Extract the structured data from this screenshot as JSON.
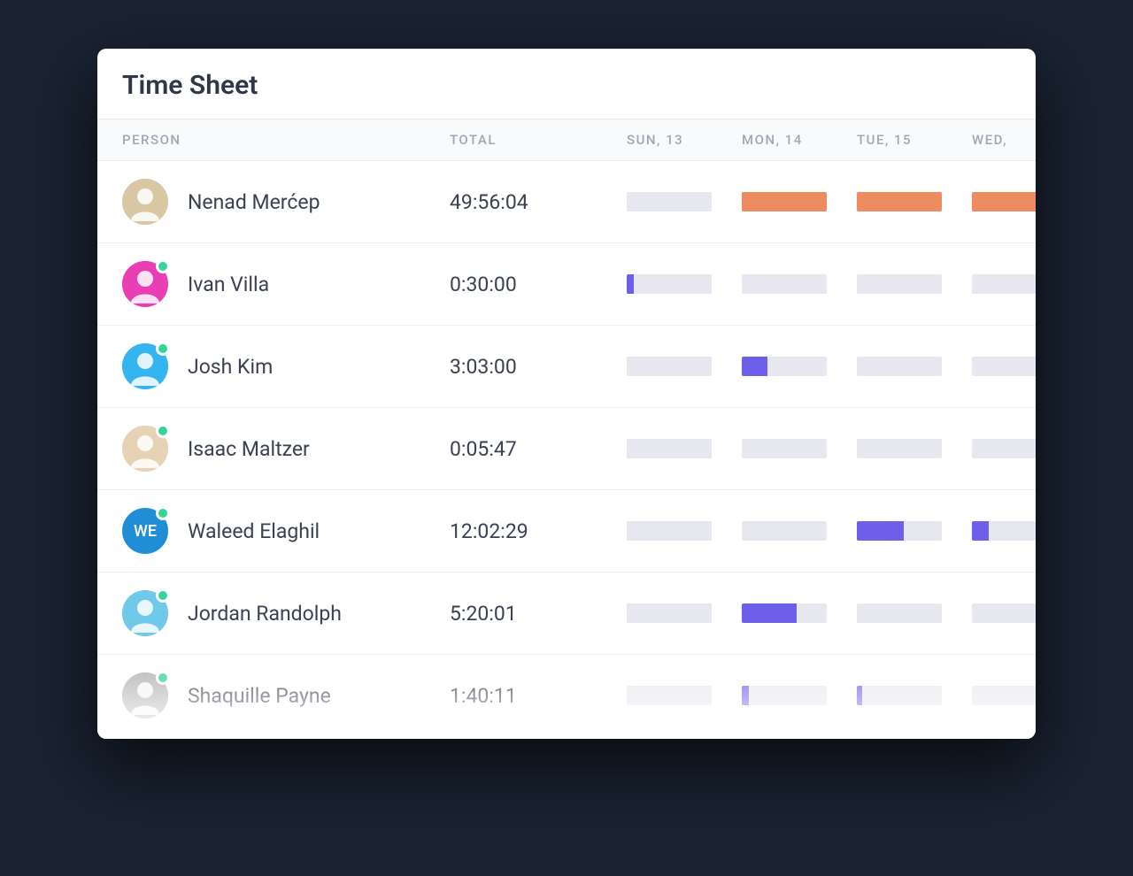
{
  "title": "Time Sheet",
  "columns": {
    "person": "PERSON",
    "total": "TOTAL",
    "days": [
      "SUN, 13",
      "MON, 14",
      "TUE, 15",
      "WED,"
    ]
  },
  "colors": {
    "orange": "#ee8b61",
    "purple": "#6e5fea",
    "track": "#e7e8ef"
  },
  "rows": [
    {
      "name": "Nenad Merćep",
      "total": "49:56:04",
      "presence": false,
      "avatar": {
        "type": "photo",
        "bg": "#d9c7a3"
      },
      "bars": [
        {
          "pct": 0,
          "color": "orange"
        },
        {
          "pct": 100,
          "color": "orange"
        },
        {
          "pct": 100,
          "color": "orange"
        },
        {
          "pct": 100,
          "color": "orange"
        }
      ]
    },
    {
      "name": "Ivan Villa",
      "total": "0:30:00",
      "presence": true,
      "avatar": {
        "type": "photo",
        "bg": "#e83fb5"
      },
      "bars": [
        {
          "pct": 8,
          "color": "purple"
        },
        {
          "pct": 0,
          "color": "purple"
        },
        {
          "pct": 0,
          "color": "purple"
        },
        {
          "pct": 0,
          "color": "purple"
        }
      ]
    },
    {
      "name": "Josh Kim",
      "total": "3:03:00",
      "presence": true,
      "avatar": {
        "type": "photo",
        "bg": "#35b5ef"
      },
      "bars": [
        {
          "pct": 0,
          "color": "purple"
        },
        {
          "pct": 30,
          "color": "purple"
        },
        {
          "pct": 0,
          "color": "purple"
        },
        {
          "pct": 0,
          "color": "purple"
        }
      ]
    },
    {
      "name": "Isaac Maltzer",
      "total": "0:05:47",
      "presence": true,
      "avatar": {
        "type": "photo",
        "bg": "#e6d2b5"
      },
      "bars": [
        {
          "pct": 0,
          "color": "purple"
        },
        {
          "pct": 0,
          "color": "purple"
        },
        {
          "pct": 0,
          "color": "purple"
        },
        {
          "pct": 0,
          "color": "purple"
        }
      ]
    },
    {
      "name": "Waleed Elaghil",
      "total": "12:02:29",
      "presence": true,
      "avatar": {
        "type": "initials",
        "text": "WE",
        "bg": "#1f8ed6"
      },
      "bars": [
        {
          "pct": 0,
          "color": "purple"
        },
        {
          "pct": 0,
          "color": "purple"
        },
        {
          "pct": 55,
          "color": "purple"
        },
        {
          "pct": 20,
          "color": "purple"
        }
      ]
    },
    {
      "name": "Jordan Randolph",
      "total": "5:20:01",
      "presence": true,
      "avatar": {
        "type": "photo",
        "bg": "#6fc9e8"
      },
      "bars": [
        {
          "pct": 0,
          "color": "purple"
        },
        {
          "pct": 65,
          "color": "purple"
        },
        {
          "pct": 0,
          "color": "purple"
        },
        {
          "pct": 0,
          "color": "purple"
        }
      ]
    },
    {
      "name": "Shaquille Payne",
      "total": "1:40:11",
      "presence": true,
      "avatar": {
        "type": "photo",
        "bg": "#b3b3b3"
      },
      "bars": [
        {
          "pct": 0,
          "color": "purple"
        },
        {
          "pct": 8,
          "color": "purple"
        },
        {
          "pct": 6,
          "color": "purple"
        },
        {
          "pct": 0,
          "color": "purple"
        }
      ]
    }
  ]
}
